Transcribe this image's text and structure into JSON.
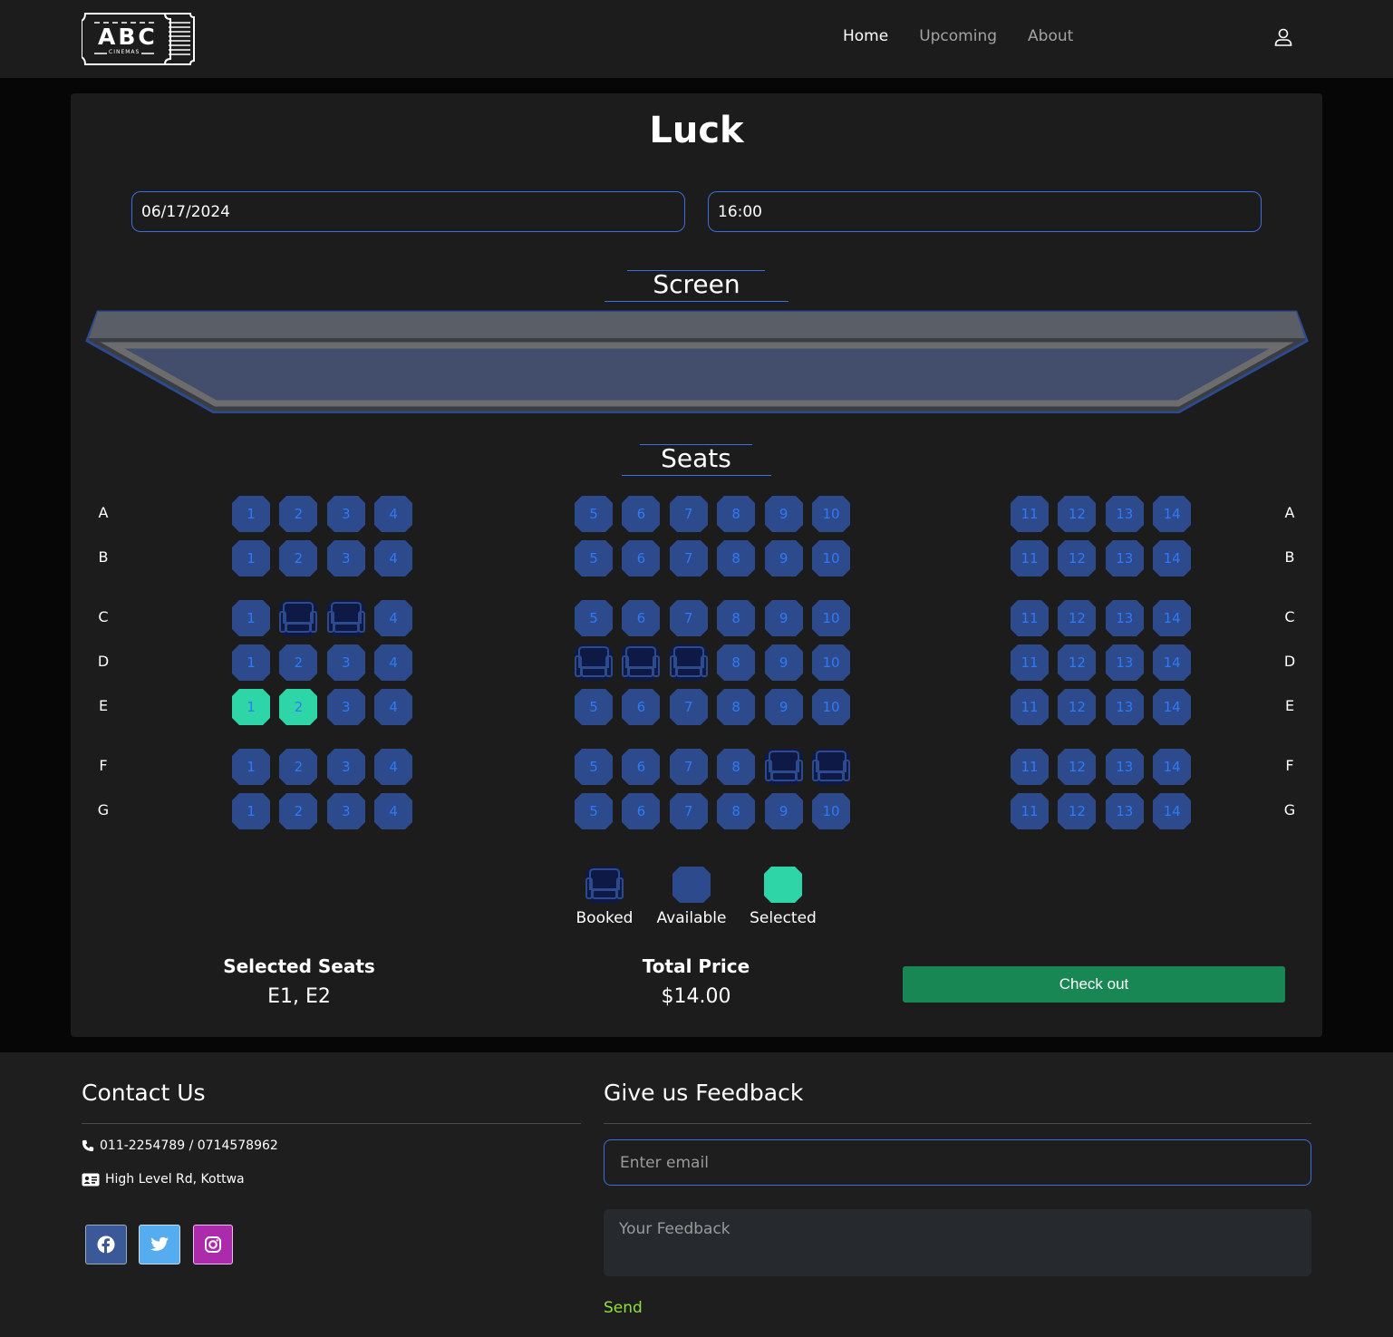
{
  "nav": {
    "logo_text": "ABC",
    "logo_sub": "CINEMAS",
    "links": [
      "Home",
      "Upcoming",
      "About"
    ],
    "active_link": "Home"
  },
  "movie": {
    "title": "Luck",
    "date": "06/17/2024",
    "time": "16:00"
  },
  "screen_heading": "Screen",
  "seats_heading": "Seats",
  "rows": [
    "A",
    "B",
    "C",
    "D",
    "E",
    "F",
    "G"
  ],
  "seat_blocks": [
    [
      "1",
      "2",
      "3",
      "4"
    ],
    [
      "5",
      "6",
      "7",
      "8",
      "9",
      "10"
    ],
    [
      "11",
      "12",
      "13",
      "14"
    ]
  ],
  "booked_seats": [
    "C2",
    "C3",
    "D5",
    "D6",
    "D7",
    "F9",
    "F10"
  ],
  "selected_seats_list": [
    "E1",
    "E2"
  ],
  "colors": {
    "available": "#2c4a8c",
    "available_number": "#2f7af6",
    "booked": "#0e1a45",
    "booked_outline": "#2c4a8c",
    "selected": "#2ed6a7",
    "checkout": "#198754",
    "accent": "#3a6fe0",
    "facebook": "#3b5998",
    "twitter": "#55acee",
    "instagram": "#ac2bac",
    "send": "#8fe13b"
  },
  "legend": {
    "booked": "Booked",
    "available": "Available",
    "selected": "Selected"
  },
  "summary": {
    "selected_label": "Selected Seats",
    "selected_value": "E1, E2",
    "total_label": "Total Price",
    "total_value": "$14.00",
    "checkout_label": "Check out"
  },
  "footer": {
    "contact_title": "Contact Us",
    "phone": "011-2254789 / 0714578962",
    "address": "High Level Rd, Kottwa",
    "social": [
      "facebook-icon",
      "twitter-icon",
      "instagram-icon"
    ],
    "feedback_title": "Give us Feedback",
    "email_placeholder": "Enter email",
    "feedback_placeholder": "Your Feedback",
    "send_label": "Send"
  }
}
